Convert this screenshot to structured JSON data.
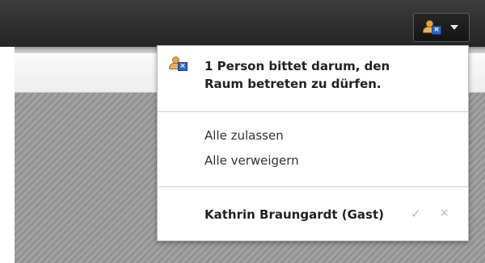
{
  "toolbar": {
    "status_icon": "user-x-icon",
    "menu_caret_icon": "caret-down-icon"
  },
  "dropdown": {
    "header_icon": "user-x-icon",
    "message_line1": "1 Person bittet darum, den",
    "message_line2": "Raum betreten zu dürfen.",
    "actions": {
      "allow_all": "Alle zulassen",
      "deny_all": "Alle verweigern"
    },
    "requests": [
      {
        "name": "Kathrin Braungardt (Gast)",
        "allow_glyph": "✓",
        "deny_glyph": "×"
      }
    ]
  },
  "colors": {
    "topbar": "#2e2e2e",
    "stage_stripes": "#9c9c9c",
    "accent_badge": "#2f67c7",
    "user_icon": "#e7a640"
  }
}
